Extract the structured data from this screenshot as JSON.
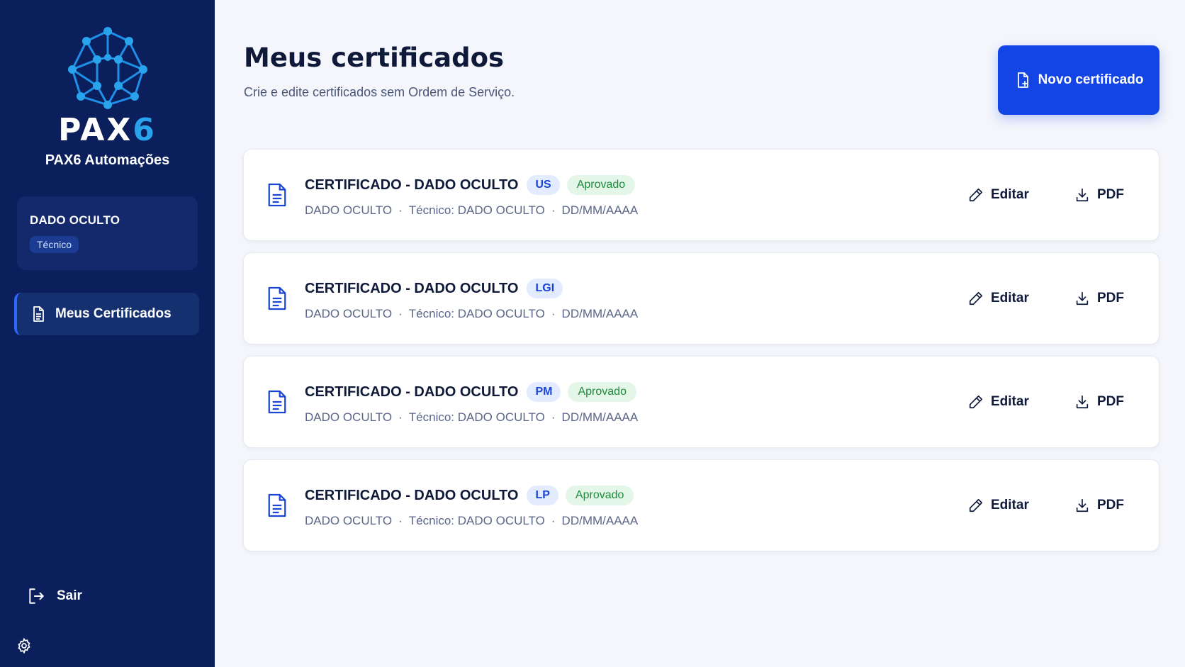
{
  "sidebar": {
    "brand_wordmark_letters": "PAX",
    "brand_wordmark_digit": "6",
    "brand_name": "PAX6 Automações",
    "user": {
      "name": "DADO OCULTO",
      "role": "Técnico"
    },
    "nav": [
      {
        "label": "Meus Certificados",
        "icon": "document-icon",
        "active": true
      }
    ],
    "logout_label": "Sair",
    "settings_icon": "gear-icon"
  },
  "header": {
    "title": "Meus certificados",
    "subtitle": "Crie e edite certificados sem Ordem de Serviço.",
    "new_button_label": "Novo certificado"
  },
  "certificates": [
    {
      "title": "CERTIFICADO - DADO OCULTO",
      "code": "US",
      "status": "Aprovado",
      "client": "DADO OCULTO",
      "technician": "Técnico: DADO OCULTO",
      "date": "DD/MM/AAAA",
      "edit_label": "Editar",
      "pdf_label": "PDF"
    },
    {
      "title": "CERTIFICADO - DADO OCULTO",
      "code": "LGI",
      "status": "",
      "client": "DADO OCULTO",
      "technician": "Técnico: DADO OCULTO",
      "date": "DD/MM/AAAA",
      "edit_label": "Editar",
      "pdf_label": "PDF"
    },
    {
      "title": "CERTIFICADO - DADO OCULTO",
      "code": "PM",
      "status": "Aprovado",
      "client": "DADO OCULTO",
      "technician": "Técnico: DADO OCULTO",
      "date": "DD/MM/AAAA",
      "edit_label": "Editar",
      "pdf_label": "PDF"
    },
    {
      "title": "CERTIFICADO - DADO OCULTO",
      "code": "LP",
      "status": "Aprovado",
      "client": "DADO OCULTO",
      "technician": "Técnico: DADO OCULTO",
      "date": "DD/MM/AAAA",
      "edit_label": "Editar",
      "pdf_label": "PDF"
    }
  ],
  "colors": {
    "sidebar_bg": "#0a1f5c",
    "accent": "#1244e6",
    "approved_bg": "#e3f6e8",
    "approved_text": "#1e8a3c",
    "code_bg": "#e3ebff",
    "code_text": "#1a45d6"
  }
}
